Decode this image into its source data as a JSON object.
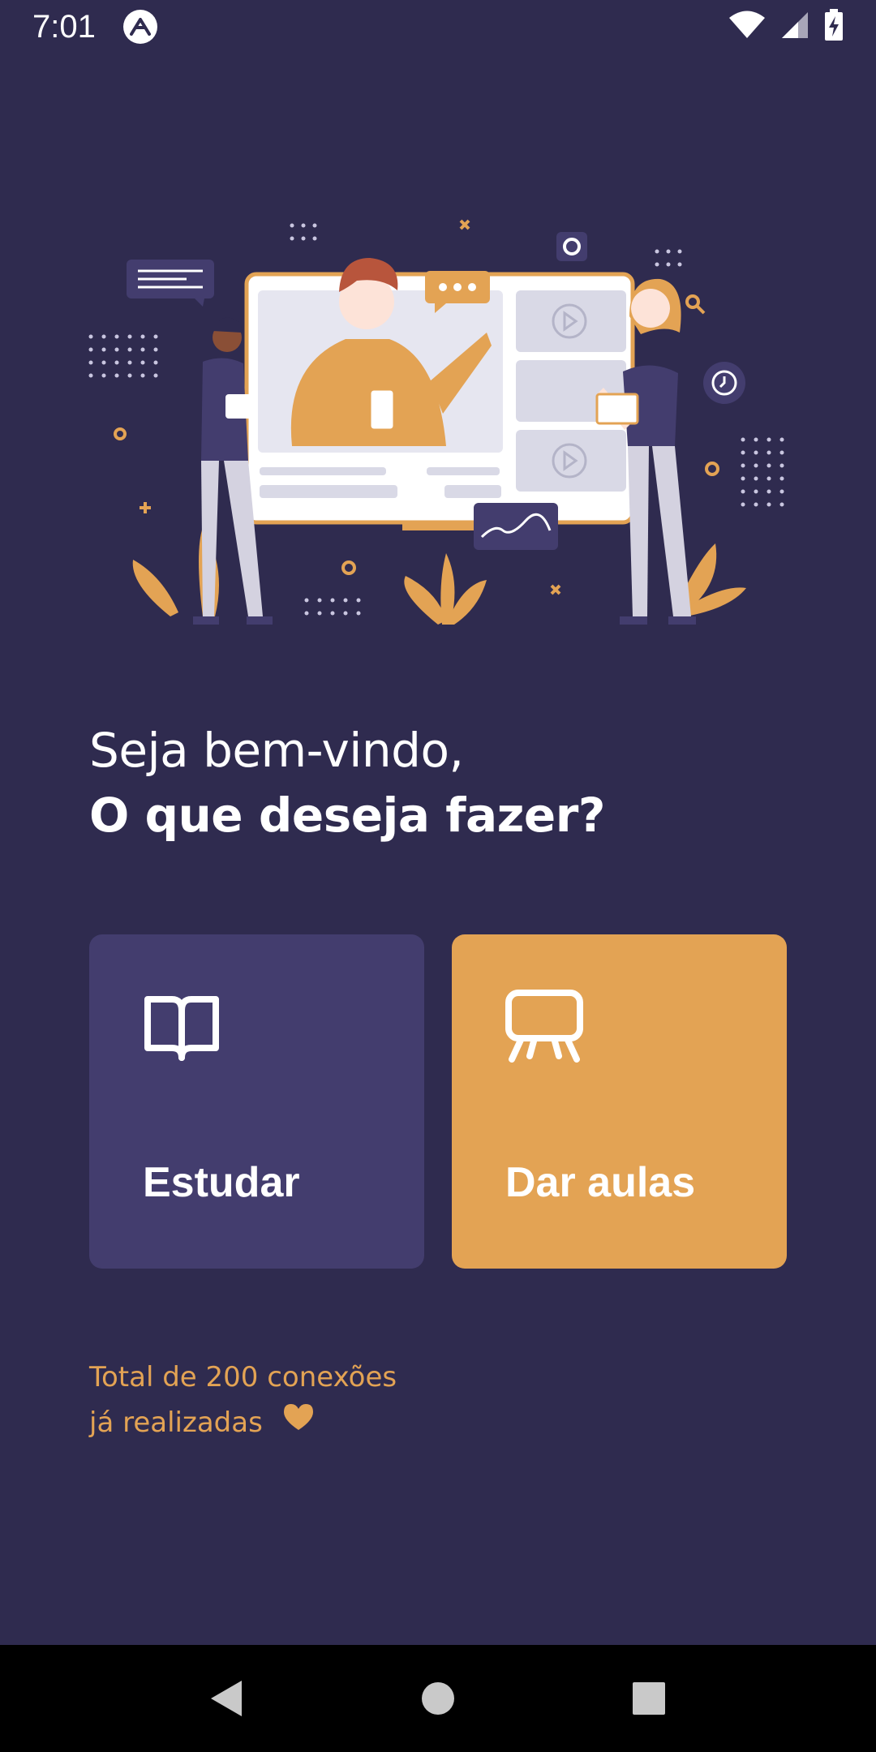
{
  "status_bar": {
    "time": "7:01",
    "app_icon": "expo-icon",
    "icons": [
      "wifi-icon",
      "signal-icon",
      "battery-charging-icon"
    ]
  },
  "hero": {
    "illustration": "online-classroom-illustration"
  },
  "welcome": {
    "line1": "Seja bem-vindo,",
    "line2": "O que deseja fazer?"
  },
  "actions": {
    "study": {
      "label": "Estudar",
      "icon": "book-open-icon",
      "color": "#433d6e"
    },
    "teach": {
      "label": "Dar aulas",
      "icon": "presentation-icon",
      "color": "#e3a354"
    }
  },
  "footer": {
    "line1": "Total de 200 conexões",
    "line2": "já realizadas",
    "icon": "heart-icon"
  },
  "nav_bar": {
    "buttons": [
      "back-icon",
      "home-icon",
      "recents-icon"
    ]
  },
  "colors": {
    "background": "#2f2b4f",
    "accent": "#e3a354",
    "card_purple": "#433d6e"
  }
}
